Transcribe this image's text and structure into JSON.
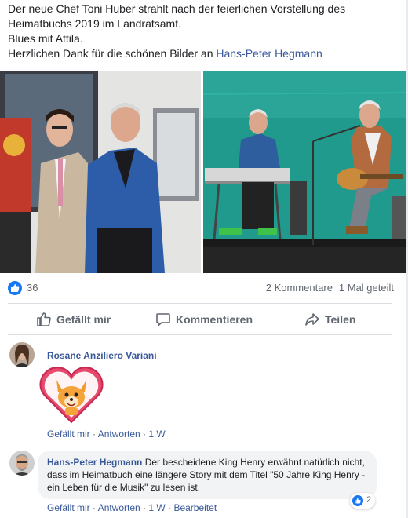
{
  "post": {
    "line1": "Der neue Chef Toni Huber strahlt nach der feierlichen Vorstellung des",
    "line2": "Heimatbuchs 2019 im Landratsamt.",
    "line3": "Blues mit Attila.",
    "line4_prefix": "Herzlichen Dank für die schönen Bilder an ",
    "line4_link": "Hans-Peter Hegmann"
  },
  "stats": {
    "likes": "36",
    "comments": "2 Kommentare",
    "shares": "1 Mal geteilt"
  },
  "actions": {
    "like": "Gefällt mir",
    "comment": "Kommentieren",
    "share": "Teilen"
  },
  "comments": [
    {
      "author": "Rosane Anziliero Variani",
      "like": "Gefällt mir",
      "reply": "Antworten",
      "time": "1 W"
    },
    {
      "author": "Hans-Peter Hegmann",
      "text": "Der bescheidene King Henry erwähnt natürlich nicht, dass im Heimatbuch eine längere Story mit dem Titel \"50 Jahre King Henry - ein Leben für die Musik\" zu lesen ist.",
      "like": "Gefällt mir",
      "reply": "Antworten",
      "time": "1 W",
      "edited": "Bearbeitet",
      "reactions": "2"
    }
  ],
  "colors": {
    "link": "#385898",
    "accent": "#1877f2",
    "secondary_text": "#606770"
  }
}
